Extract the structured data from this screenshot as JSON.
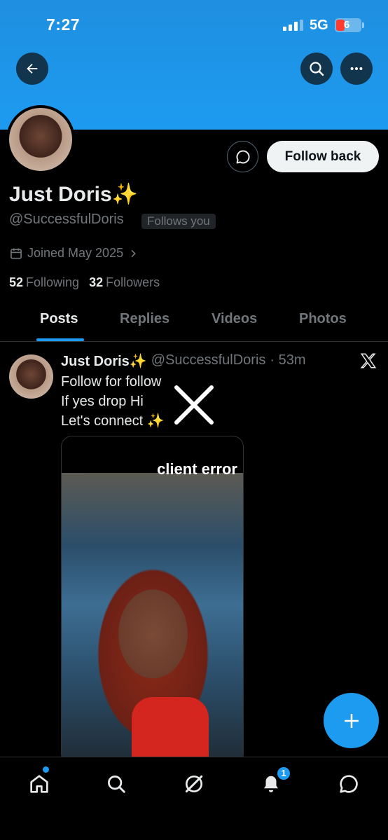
{
  "status_bar": {
    "time": "7:27",
    "network": "5G",
    "battery": "6"
  },
  "profile": {
    "display_name": "Just Doris✨",
    "handle": "@SuccessfulDoris",
    "follows_you": "Follows you",
    "joined": "Joined May 2025",
    "following_count": "52",
    "following_label": "Following",
    "followers_count": "32",
    "followers_label": "Followers",
    "follow_back_label": "Follow back"
  },
  "tabs": [
    {
      "label": "Posts",
      "active": true
    },
    {
      "label": "Replies",
      "active": false
    },
    {
      "label": "Videos",
      "active": false
    },
    {
      "label": "Photos",
      "active": false
    }
  ],
  "post": {
    "name": "Just Doris✨",
    "handle": "@SuccessfulDoris",
    "time": "· 53m",
    "lines": [
      "Follow for follow",
      "If yes drop Hi",
      "Let's connect ✨"
    ],
    "media_error": "client error"
  },
  "bottom_nav": {
    "items": [
      "home-icon",
      "search-icon",
      "grok-icon",
      "bell-icon",
      "message-icon"
    ],
    "notification_count": "1"
  },
  "colors": {
    "accent": "#1d9bf0",
    "background": "#000000",
    "secondary_text": "#71767b"
  }
}
